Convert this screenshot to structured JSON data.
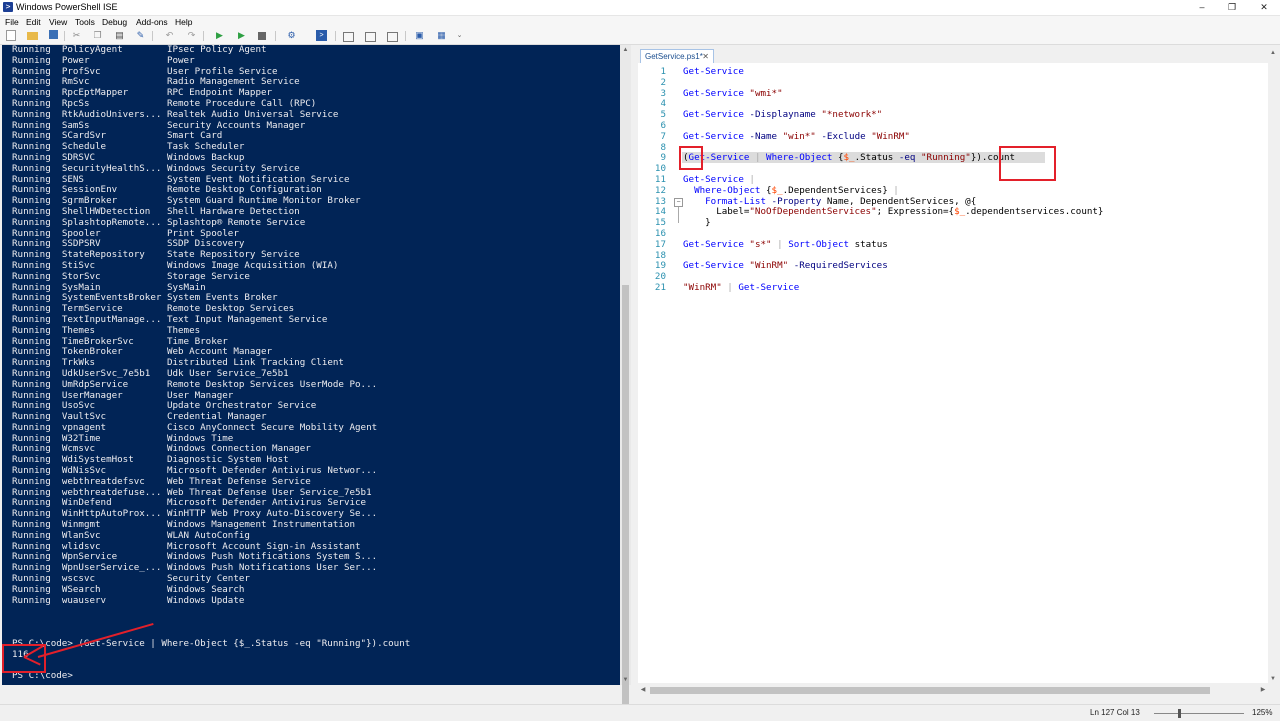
{
  "window": {
    "title": "Windows PowerShell ISE",
    "controls": [
      "–",
      "❐",
      "✕"
    ]
  },
  "menu": [
    "File",
    "Edit",
    "View",
    "Tools",
    "Debug",
    "Add-ons",
    "Help"
  ],
  "toolbar": {
    "icons": [
      "new-file-icon",
      "open-icon",
      "save-icon",
      "cut-icon",
      "copy-icon",
      "paste-icon",
      "clear-icon",
      "undo-icon",
      "redo-icon",
      "run-icon",
      "run-selection-icon",
      "stop-icon",
      "remote-icon",
      "powershell-icon",
      "layout-top-icon",
      "layout-right-icon",
      "layout-max-icon",
      "show-script-icon",
      "command-addon-icon"
    ]
  },
  "console": {
    "services": [
      [
        "Running",
        "PolicyAgent",
        "IPsec Policy Agent"
      ],
      [
        "Running",
        "Power",
        "Power"
      ],
      [
        "Running",
        "ProfSvc",
        "User Profile Service"
      ],
      [
        "Running",
        "RmSvc",
        "Radio Management Service"
      ],
      [
        "Running",
        "RpcEptMapper",
        "RPC Endpoint Mapper"
      ],
      [
        "Running",
        "RpcSs",
        "Remote Procedure Call (RPC)"
      ],
      [
        "Running",
        "RtkAudioUnivers...",
        "Realtek Audio Universal Service"
      ],
      [
        "Running",
        "SamSs",
        "Security Accounts Manager"
      ],
      [
        "Running",
        "SCardSvr",
        "Smart Card"
      ],
      [
        "Running",
        "Schedule",
        "Task Scheduler"
      ],
      [
        "Running",
        "SDRSVC",
        "Windows Backup"
      ],
      [
        "Running",
        "SecurityHealthS...",
        "Windows Security Service"
      ],
      [
        "Running",
        "SENS",
        "System Event Notification Service"
      ],
      [
        "Running",
        "SessionEnv",
        "Remote Desktop Configuration"
      ],
      [
        "Running",
        "SgrmBroker",
        "System Guard Runtime Monitor Broker"
      ],
      [
        "Running",
        "ShellHWDetection",
        "Shell Hardware Detection"
      ],
      [
        "Running",
        "SplashtopRemote...",
        "Splashtop® Remote Service"
      ],
      [
        "Running",
        "Spooler",
        "Print Spooler"
      ],
      [
        "Running",
        "SSDPSRV",
        "SSDP Discovery"
      ],
      [
        "Running",
        "StateRepository",
        "State Repository Service"
      ],
      [
        "Running",
        "StiSvc",
        "Windows Image Acquisition (WIA)"
      ],
      [
        "Running",
        "StorSvc",
        "Storage Service"
      ],
      [
        "Running",
        "SysMain",
        "SysMain"
      ],
      [
        "Running",
        "SystemEventsBroker",
        "System Events Broker"
      ],
      [
        "Running",
        "TermService",
        "Remote Desktop Services"
      ],
      [
        "Running",
        "TextInputManage...",
        "Text Input Management Service"
      ],
      [
        "Running",
        "Themes",
        "Themes"
      ],
      [
        "Running",
        "TimeBrokerSvc",
        "Time Broker"
      ],
      [
        "Running",
        "TokenBroker",
        "Web Account Manager"
      ],
      [
        "Running",
        "TrkWks",
        "Distributed Link Tracking Client"
      ],
      [
        "Running",
        "UdkUserSvc_7e5b1",
        "Udk User Service_7e5b1"
      ],
      [
        "Running",
        "UmRdpService",
        "Remote Desktop Services UserMode Po..."
      ],
      [
        "Running",
        "UserManager",
        "User Manager"
      ],
      [
        "Running",
        "UsoSvc",
        "Update Orchestrator Service"
      ],
      [
        "Running",
        "VaultSvc",
        "Credential Manager"
      ],
      [
        "Running",
        "vpnagent",
        "Cisco AnyConnect Secure Mobility Agent"
      ],
      [
        "Running",
        "W32Time",
        "Windows Time"
      ],
      [
        "Running",
        "Wcmsvc",
        "Windows Connection Manager"
      ],
      [
        "Running",
        "WdiSystemHost",
        "Diagnostic System Host"
      ],
      [
        "Running",
        "WdNisSvc",
        "Microsoft Defender Antivirus Networ..."
      ],
      [
        "Running",
        "webthreatdefsvc",
        "Web Threat Defense Service"
      ],
      [
        "Running",
        "webthreatdefuse...",
        "Web Threat Defense User Service_7e5b1"
      ],
      [
        "Running",
        "WinDefend",
        "Microsoft Defender Antivirus Service"
      ],
      [
        "Running",
        "WinHttpAutoProx...",
        "WinHTTP Web Proxy Auto-Discovery Se..."
      ],
      [
        "Running",
        "Winmgmt",
        "Windows Management Instrumentation"
      ],
      [
        "Running",
        "WlanSvc",
        "WLAN AutoConfig"
      ],
      [
        "Running",
        "wlidsvc",
        "Microsoft Account Sign-in Assistant"
      ],
      [
        "Running",
        "WpnService",
        "Windows Push Notifications System S..."
      ],
      [
        "Running",
        "WpnUserService_...",
        "Windows Push Notifications User Ser..."
      ],
      [
        "Running",
        "wscsvc",
        "Security Center"
      ],
      [
        "Running",
        "WSearch",
        "Windows Search"
      ],
      [
        "Running",
        "wuauserv",
        "Windows Update"
      ]
    ],
    "command_line": "PS C:\\code> (Get-Service | Where-Object {$_.Status -eq \"Running\"}).count",
    "result": "116",
    "prompt": "PS C:\\code>"
  },
  "editor": {
    "tab_label": "GetService.ps1*",
    "tab_close": "✕",
    "line_numbers": [
      "1",
      "2",
      "3",
      "4",
      "5",
      "6",
      "7",
      "8",
      "9",
      "10",
      "11",
      "12",
      "13",
      "14",
      "15",
      "16",
      "17",
      "18",
      "19",
      "20",
      "21"
    ],
    "lines": [
      "Get-Service",
      "",
      "Get-Service \"wmi*\"",
      "",
      "Get-Service -Displayname \"*network*\"",
      "",
      "Get-Service -Name \"win*\" -Exclude \"WinRM\"",
      "",
      "(Get-Service | Where-Object {$_.Status -eq \"Running\"}).count",
      "",
      "Get-Service |",
      "  Where-Object {$_.DependentServices} |",
      "    Format-List -Property Name, DependentServices, @{",
      "      Label=\"NoOfDependentServices\"; Expression={$_.dependentservices.count}",
      "    }",
      "",
      "Get-Service \"s*\" | Sort-Object status",
      "",
      "Get-Service \"WinRM\" -RequiredServices",
      "",
      "\"WinRM\" | Get-Service"
    ]
  },
  "status": {
    "position": "Ln 127  Col 13",
    "zoom": "125%",
    "zoom_level": 0.25
  },
  "colors": {
    "console_bg": "#012456",
    "console_fg": "#eeedf0",
    "annotation_red": "#e3202a",
    "line_number": "#2b91af"
  }
}
